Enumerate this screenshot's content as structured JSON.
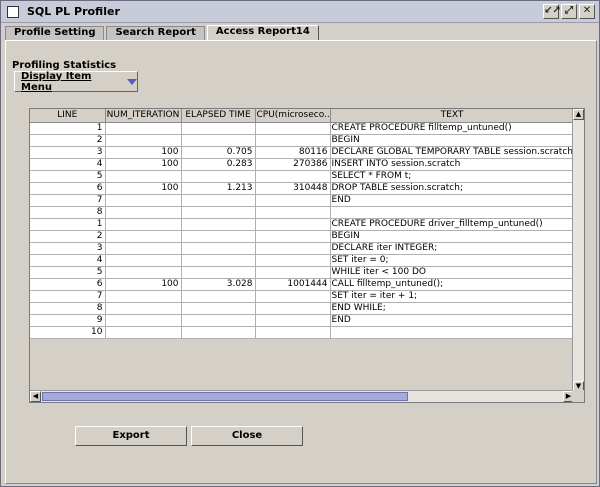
{
  "window": {
    "title": "SQL PL Profiler"
  },
  "titlebar_buttons": [
    "↙↗",
    "⤢",
    "✕"
  ],
  "tabs": [
    {
      "label": "Profile Setting",
      "active": false
    },
    {
      "label": "Search Report",
      "active": false
    },
    {
      "label": "Access Report14",
      "active": true
    }
  ],
  "section": {
    "label": "Profiling Statistics"
  },
  "menu": {
    "label": "Display Item Menu"
  },
  "table": {
    "columns": [
      "LINE",
      "NUM_ITERATION",
      "ELAPSED TIME",
      "CPU(microseco...",
      "TEXT"
    ],
    "rows": [
      [
        "1",
        "",
        "",
        "",
        "CREATE PROCEDURE filltemp_untuned()"
      ],
      [
        "2",
        "",
        "",
        "",
        "BEGIN"
      ],
      [
        "3",
        "100",
        "0.705",
        "80116",
        " DECLARE GLOBAL TEMPORARY TABLE session.scratch L"
      ],
      [
        "4",
        "100",
        "0.283",
        "270386",
        " INSERT INTO session.scratch"
      ],
      [
        "5",
        "",
        "",
        "",
        "   SELECT * FROM t;"
      ],
      [
        "6",
        "100",
        "1.213",
        "310448",
        " DROP TABLE session.scratch;"
      ],
      [
        "7",
        "",
        "",
        "",
        "END"
      ],
      [
        "8",
        "",
        "",
        "",
        ""
      ],
      [
        "1",
        "",
        "",
        "",
        "CREATE PROCEDURE driver_filltemp_untuned()"
      ],
      [
        "2",
        "",
        "",
        "",
        "BEGIN"
      ],
      [
        "3",
        "",
        "",
        "",
        "  DECLARE iter INTEGER;"
      ],
      [
        "4",
        "",
        "",
        "",
        "  SET iter = 0;"
      ],
      [
        "5",
        "",
        "",
        "",
        "  WHILE iter < 100 DO"
      ],
      [
        "6",
        "100",
        "3.028",
        "1001444",
        "    CALL filltemp_untuned();"
      ],
      [
        "7",
        "",
        "",
        "",
        "    SET iter = iter + 1;"
      ],
      [
        "8",
        "",
        "",
        "",
        "  END WHILE;"
      ],
      [
        "9",
        "",
        "",
        "",
        "END"
      ],
      [
        "10",
        "",
        "",
        "",
        ""
      ]
    ]
  },
  "buttons": {
    "export": "Export",
    "close": "Close"
  }
}
